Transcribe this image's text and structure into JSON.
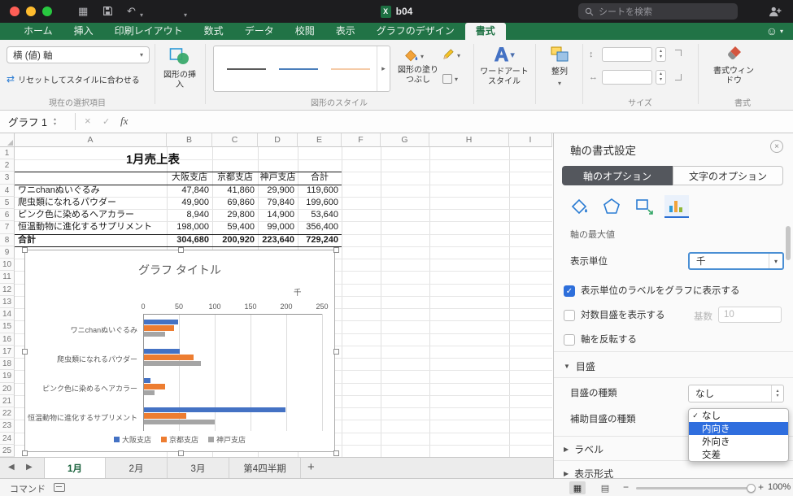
{
  "titlebar": {
    "doc_title": "b04",
    "search_placeholder": "シートを検索"
  },
  "ribbon": {
    "tabs": [
      {
        "label": "ホーム"
      },
      {
        "label": "挿入"
      },
      {
        "label": "印刷レイアウト"
      },
      {
        "label": "数式"
      },
      {
        "label": "データ"
      },
      {
        "label": "校閲"
      },
      {
        "label": "表示"
      },
      {
        "label": "グラフのデザイン"
      },
      {
        "label": "書式",
        "active": true
      }
    ],
    "selection_combo": "横 (値) 軸",
    "reset_button": "リセットしてスタイルに合わせる",
    "group_current_selection": "現在の選択項目",
    "insert_shapes": "図形の挿入",
    "group_shape_styles": "図形のスタイル",
    "shape_fill": "図形の塗りつぶし",
    "wordart_label": "ワードアートスタイル",
    "arrange_label": "整列",
    "group_size": "サイズ",
    "format_pane_label": "書式ウィンドウ",
    "group_format": "書式"
  },
  "formula_bar": {
    "name_box": "グラフ 1",
    "fx_label": "fx"
  },
  "sheet": {
    "columns": [
      "A",
      "B",
      "C",
      "D",
      "E",
      "F",
      "G",
      "H",
      "I"
    ],
    "row_count": 25,
    "title_cell": "1月売上表",
    "table_headers": [
      "大阪支店",
      "京都支店",
      "神戸支店",
      "合計"
    ],
    "table_rows": [
      {
        "label": "ワニchanぬいぐるみ",
        "values": [
          "47,840",
          "41,860",
          "29,900",
          "119,600"
        ]
      },
      {
        "label": "爬虫類になれるパウダー",
        "values": [
          "49,900",
          "69,860",
          "79,840",
          "199,600"
        ]
      },
      {
        "label": "ピンク色に染めるヘアカラー",
        "values": [
          "8,940",
          "29,800",
          "14,900",
          "53,640"
        ]
      },
      {
        "label": "恒温動物に進化するサプリメント",
        "values": [
          "198,000",
          "59,400",
          "99,000",
          "356,400"
        ]
      },
      {
        "label": "合計",
        "values": [
          "304,680",
          "200,920",
          "223,640",
          "729,240"
        ],
        "bold": true
      }
    ]
  },
  "chart_data": {
    "type": "bar",
    "orientation": "horizontal",
    "title": "グラフ タイトル",
    "unit_label": "千",
    "categories": [
      "ワニchanぬいぐるみ",
      "爬虫類になれるパウダー",
      "ピンク色に染めるヘアカラー",
      "恒温動物に進化するサプリメント"
    ],
    "series": [
      {
        "name": "大阪支店",
        "color": "#4472c4",
        "values_thousands": [
          47.84,
          49.9,
          8.94,
          198.0
        ]
      },
      {
        "name": "京都支店",
        "color": "#ed7d31",
        "values_thousands": [
          41.86,
          69.86,
          29.8,
          59.4
        ]
      },
      {
        "name": "神戸支店",
        "color": "#a5a5a5",
        "values_thousands": [
          29.9,
          79.84,
          14.9,
          99.0
        ]
      }
    ],
    "xlim": [
      0,
      250
    ],
    "ticks": [
      0,
      50,
      100,
      150,
      200,
      250
    ],
    "legend_position": "bottom",
    "grid": true
  },
  "format_pane": {
    "title": "軸の書式設定",
    "tab_axis": "軸のオプション",
    "tab_text": "文字のオプション",
    "clipped_row_label": "軸の最大値",
    "display_units_label": "表示単位",
    "display_units_value": "千",
    "show_units_checkbox": "表示単位のラベルをグラフに表示する",
    "log_checkbox": "対数目盛を表示する",
    "log_base_label": "基数",
    "log_base_value": "10",
    "reverse_checkbox": "軸を反転する",
    "ticks_section": "目盛",
    "major_tick_label": "目盛の種類",
    "major_tick_value": "なし",
    "minor_tick_label": "補助目盛の種類",
    "minor_tick_menu": [
      {
        "label": "なし",
        "checked": true
      },
      {
        "label": "内向き",
        "highlighted": true
      },
      {
        "label": "外向き"
      },
      {
        "label": "交差"
      }
    ],
    "labels_section": "ラベル",
    "number_section": "表示形式"
  },
  "sheet_tabs": {
    "tabs": [
      {
        "label": "1月",
        "active": true
      },
      {
        "label": "2月"
      },
      {
        "label": "3月"
      },
      {
        "label": "第4四半期"
      }
    ],
    "add_label": "+"
  },
  "status_bar": {
    "left_label": "コマンド",
    "zoom_value": "100%"
  },
  "colors": {
    "excel_green": "#217346",
    "accent_blue": "#2e6fdb",
    "series_osaka": "#4472c4",
    "series_kyoto": "#ed7d31",
    "series_kobe": "#a5a5a5"
  }
}
